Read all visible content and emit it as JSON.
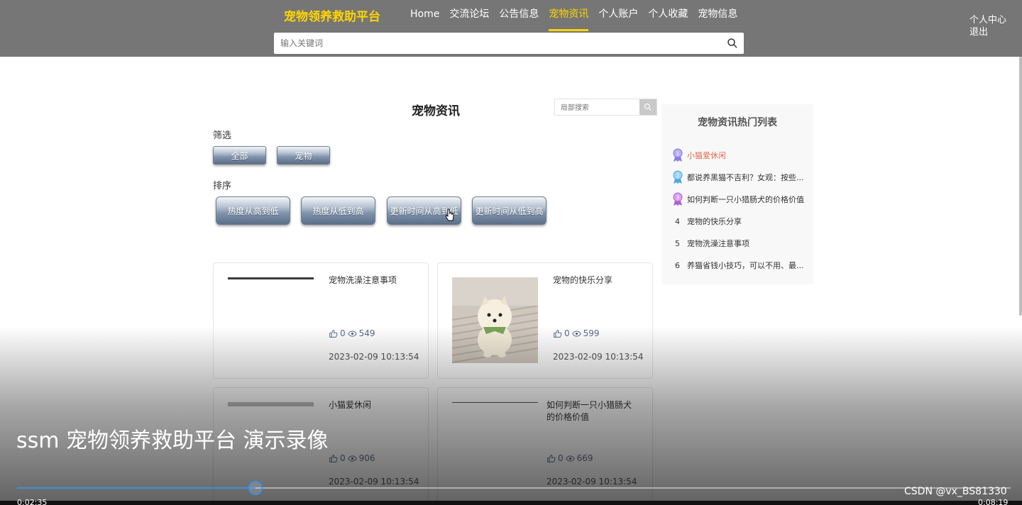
{
  "header": {
    "site_title": "宠物领养救助平台",
    "nav": [
      "Home",
      "交流论坛",
      "公告信息",
      "宠物资讯",
      "个人账户",
      "个人收藏",
      "宠物信息"
    ],
    "active_nav": "宠物资讯",
    "user_links": [
      "个人中心",
      "退出"
    ],
    "search_placeholder": "输入关键词",
    "accent_color": "#ffd400"
  },
  "main": {
    "page_title": "宠物资讯",
    "local_search_placeholder": "局部搜索",
    "filter_label": "筛选",
    "filter_buttons": [
      "全部",
      "宠物"
    ],
    "sort_label": "排序",
    "sort_buttons": [
      "热度从高到低",
      "热度从低到高",
      "更新时间从高到低",
      "更新时间从低到高"
    ]
  },
  "cards": [
    {
      "title": "宠物洗澡注意事项",
      "likes": "0",
      "views": "549",
      "date": "2023-02-09 10:13:54"
    },
    {
      "title": "宠物的快乐分享",
      "likes": "0",
      "views": "599",
      "date": "2023-02-09 10:13:54"
    },
    {
      "title": "小猫爱休闲",
      "likes": "0",
      "views": "906",
      "date": "2023-02-09 10:13:54"
    },
    {
      "title": "如何判断一只小猎肠犬的价格价值",
      "likes": "0",
      "views": "669",
      "date": "2023-02-09 10:13:54"
    }
  ],
  "hot_list": {
    "title": "宠物资讯热门列表",
    "items": [
      {
        "rank": "1",
        "text": "小猫爱休闲"
      },
      {
        "rank": "2",
        "text": "都说养黑猫不吉利？女观：按些..."
      },
      {
        "rank": "3",
        "text": "如何判断一只小猎肠犬的价格价值"
      },
      {
        "rank": "4",
        "text": "宠物的快乐分享"
      },
      {
        "rank": "5",
        "text": "宠物洗澡注意事项"
      },
      {
        "rank": "6",
        "text": "养猫省钱小技巧，可以不用、最..."
      }
    ]
  },
  "video": {
    "title": "ssm 宠物领养救助平台 演示录像",
    "current_time": "0:02:35",
    "total_time": "0:08:19",
    "progress": 0.24,
    "watermark": "CSDN @vx_BS81330"
  }
}
